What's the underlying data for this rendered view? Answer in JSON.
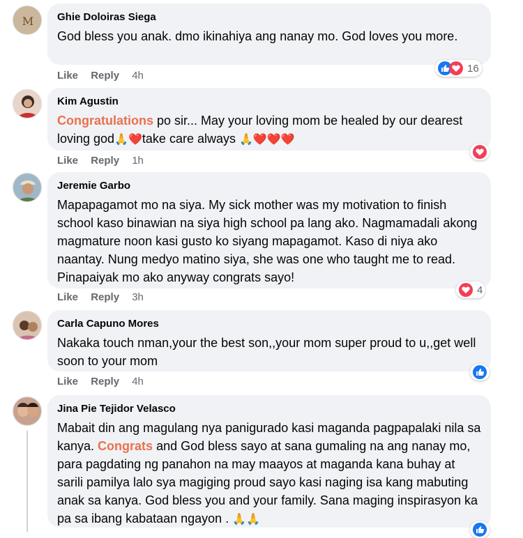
{
  "comments": [
    {
      "author": "Ghie Doloiras Siega",
      "text": "God bless you anak. dmo ikinahiya ang nanay mo. God loves you more.",
      "actions": {
        "like": "Like",
        "reply": "Reply",
        "time": "4h"
      },
      "reactions": {
        "icons": [
          "like-icon",
          "love-icon"
        ],
        "count": "16"
      }
    },
    {
      "author": "Kim Agustin",
      "highlight": "Congratulations",
      "text_after": " po sir... May your loving mom be healed by our dearest loving god",
      "text_mid": "take care always ",
      "emojis_1": "🙏❤️",
      "emojis_2": "🙏❤️❤️❤️",
      "actions": {
        "like": "Like",
        "reply": "Reply",
        "time": "1h"
      },
      "reactions": {
        "icons": [
          "love-icon"
        ],
        "count": ""
      }
    },
    {
      "author": "Jeremie Garbo",
      "text": "Mapapagamot mo na siya. My sick mother was my motivation to finish school kaso binawian na siya high school pa lang ako. Nagmamadali akong magmature noon kasi gusto ko siyang mapagamot. Kaso di niya ako naantay. Nung medyo matino siya, she was one who taught me to read. Pinapaiyak mo ako anyway congrats sayo!",
      "actions": {
        "like": "Like",
        "reply": "Reply",
        "time": "3h"
      },
      "reactions": {
        "icons": [
          "love-icon"
        ],
        "count": "4"
      }
    },
    {
      "author": "Carla Capuno Mores",
      "text": "Nakaka touch nman,your the best son,,your mom super proud to u,,get well soon to your mom",
      "actions": {
        "like": "Like",
        "reply": "Reply",
        "time": "4h"
      },
      "reactions": {
        "icons": [
          "like-icon"
        ],
        "count": ""
      }
    },
    {
      "author": "Jina Pie Tejidor Velasco",
      "text_before": "Mabait din ang magulang nya panigurado kasi maganda pagpapalaki nila sa kanya. ",
      "highlight": "Congrats",
      "text_after": " and God bless sayo at sana gumaling na ang nanay mo, para pagdating ng panahon na may maayos at maganda kana buhay at sarili pamilya lalo sya magiging proud sayo kasi naging isa kang mabuting anak sa kanya. God bless you and your family. Sana maging inspirasyon ka pa sa ibang kabataan ngayon . ",
      "emojis": "🙏🙏",
      "reactions": {
        "icons": [
          "like-icon"
        ],
        "count": ""
      }
    }
  ],
  "colors": {
    "bubble": "#f0f2f5",
    "highlight": "#e9714f",
    "like": "#1877f2",
    "love": "#f33e58"
  }
}
